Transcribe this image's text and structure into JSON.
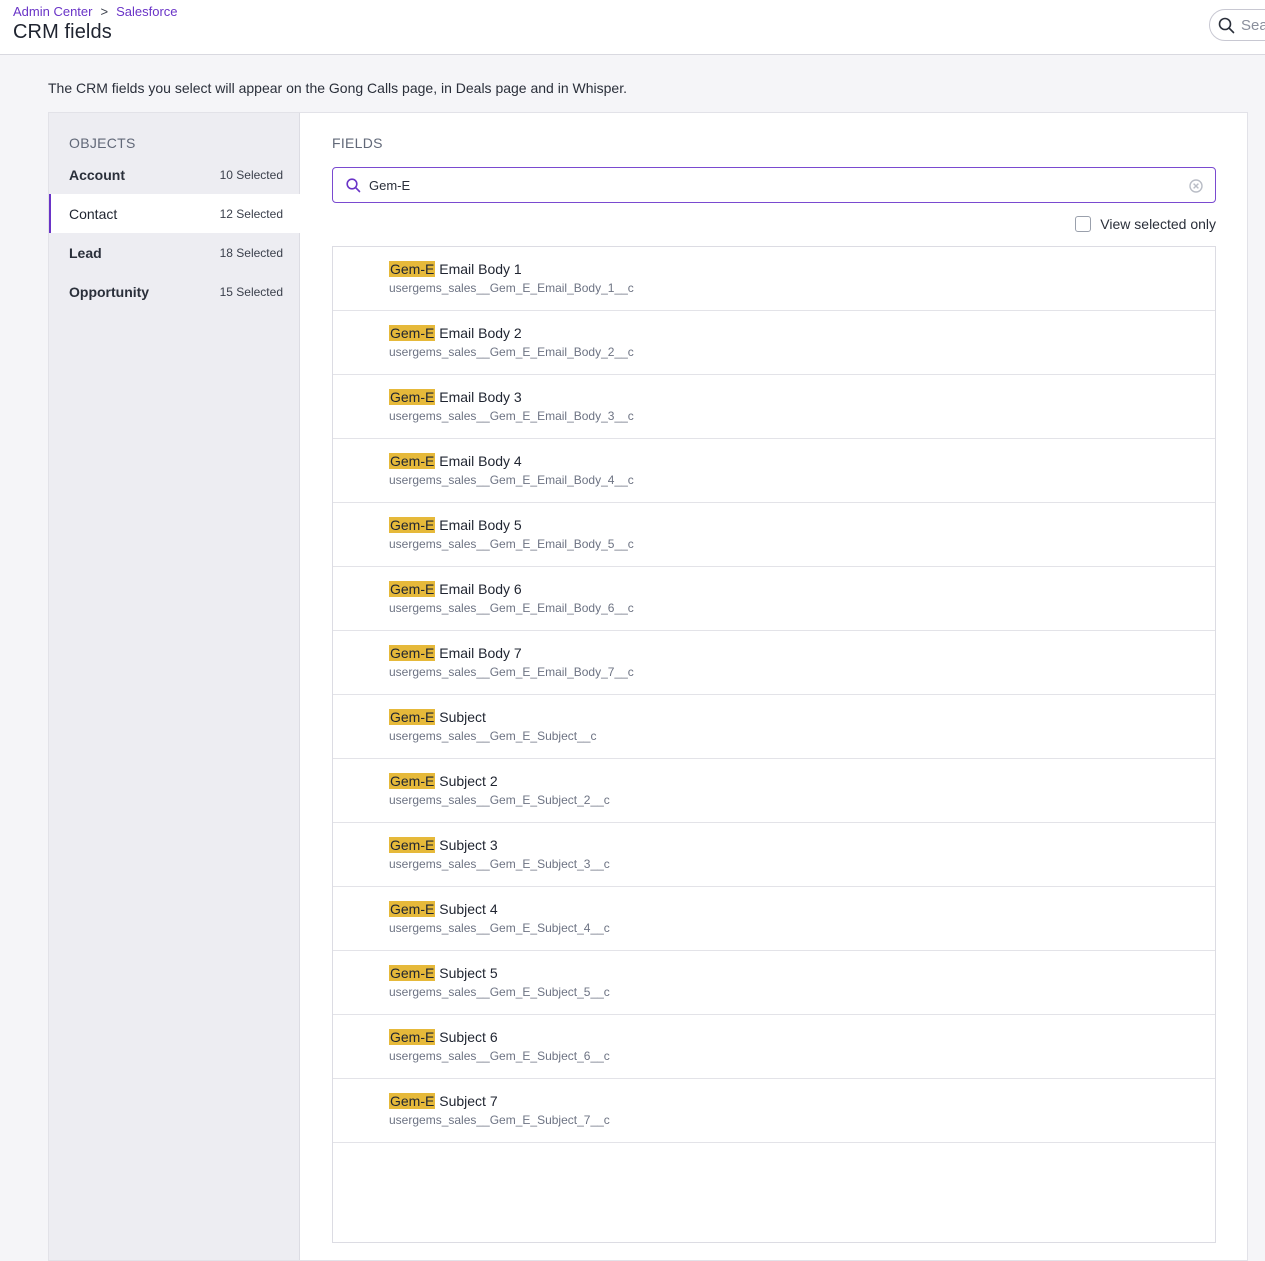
{
  "header": {
    "breadcrumb": [
      "Admin Center",
      "Salesforce"
    ],
    "breadcrumb_separator": ">",
    "title": "CRM fields",
    "search_placeholder": "Search"
  },
  "intro": "The CRM fields you select will appear on the Gong Calls page, in Deals page and in Whisper.",
  "objects": {
    "title": "OBJECTS",
    "items": [
      {
        "name": "Account",
        "count": "10 Selected",
        "active": false
      },
      {
        "name": "Contact",
        "count": "12 Selected",
        "active": true
      },
      {
        "name": "Lead",
        "count": "18 Selected",
        "active": false
      },
      {
        "name": "Opportunity",
        "count": "15 Selected",
        "active": false
      }
    ]
  },
  "fields": {
    "title": "FIELDS",
    "search_value": "Gem-E",
    "view_selected_label": "View selected only",
    "view_selected_checked": false,
    "highlight": "Gem-E",
    "items": [
      {
        "rest": " Email Body 1",
        "api": "usergems_sales__Gem_E_Email_Body_1__c"
      },
      {
        "rest": " Email Body 2",
        "api": "usergems_sales__Gem_E_Email_Body_2__c"
      },
      {
        "rest": " Email Body 3",
        "api": "usergems_sales__Gem_E_Email_Body_3__c"
      },
      {
        "rest": " Email Body 4",
        "api": "usergems_sales__Gem_E_Email_Body_4__c"
      },
      {
        "rest": " Email Body 5",
        "api": "usergems_sales__Gem_E_Email_Body_5__c"
      },
      {
        "rest": " Email Body 6",
        "api": "usergems_sales__Gem_E_Email_Body_6__c"
      },
      {
        "rest": " Email Body 7",
        "api": "usergems_sales__Gem_E_Email_Body_7__c"
      },
      {
        "rest": " Subject",
        "api": "usergems_sales__Gem_E_Subject__c"
      },
      {
        "rest": " Subject 2",
        "api": "usergems_sales__Gem_E_Subject_2__c"
      },
      {
        "rest": " Subject 3",
        "api": "usergems_sales__Gem_E_Subject_3__c"
      },
      {
        "rest": " Subject 4",
        "api": "usergems_sales__Gem_E_Subject_4__c"
      },
      {
        "rest": " Subject 5",
        "api": "usergems_sales__Gem_E_Subject_5__c"
      },
      {
        "rest": " Subject 6",
        "api": "usergems_sales__Gem_E_Subject_6__c"
      },
      {
        "rest": " Subject 7",
        "api": "usergems_sales__Gem_E_Subject_7__c"
      }
    ]
  },
  "colors": {
    "accent": "#6a34c7",
    "highlight": "#e6b93a"
  },
  "icons": [
    "search-icon",
    "chevron-right-icon",
    "clear-icon",
    "checkbox"
  ]
}
